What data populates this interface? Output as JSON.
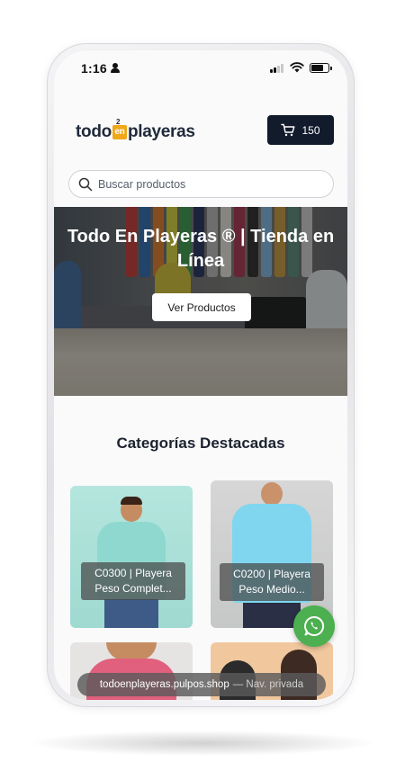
{
  "status_bar": {
    "time": "1:16"
  },
  "header": {
    "logo": {
      "part1": "todo",
      "badge": "en",
      "badge_sup": "2",
      "part2": "playeras"
    },
    "cart": {
      "count": "150"
    }
  },
  "search": {
    "placeholder": "Buscar productos"
  },
  "hero": {
    "title": "Todo En Playeras ® | Tienda en Línea",
    "button_label": "Ver Productos"
  },
  "categories": {
    "title": "Categorías Destacadas",
    "items": [
      {
        "line1": "C0300 | Playera",
        "line2": "Peso Complet..."
      },
      {
        "line1": "C0200 | Playera",
        "line2": "Peso Medio..."
      }
    ]
  },
  "browser": {
    "url": "todoenplayeras.pulpos.shop",
    "mode": "— Nav. privada"
  },
  "colors": {
    "cart_button": "#121b2c",
    "logo_accent": "#f0a81a",
    "whatsapp": "#4caf50",
    "card1_bg": "#a9e0d8",
    "card2_bg": "#cfd0d0"
  },
  "icons": [
    "person-icon",
    "signal-icon",
    "wifi-icon",
    "battery-icon",
    "cart-icon",
    "search-icon",
    "whatsapp-icon"
  ]
}
